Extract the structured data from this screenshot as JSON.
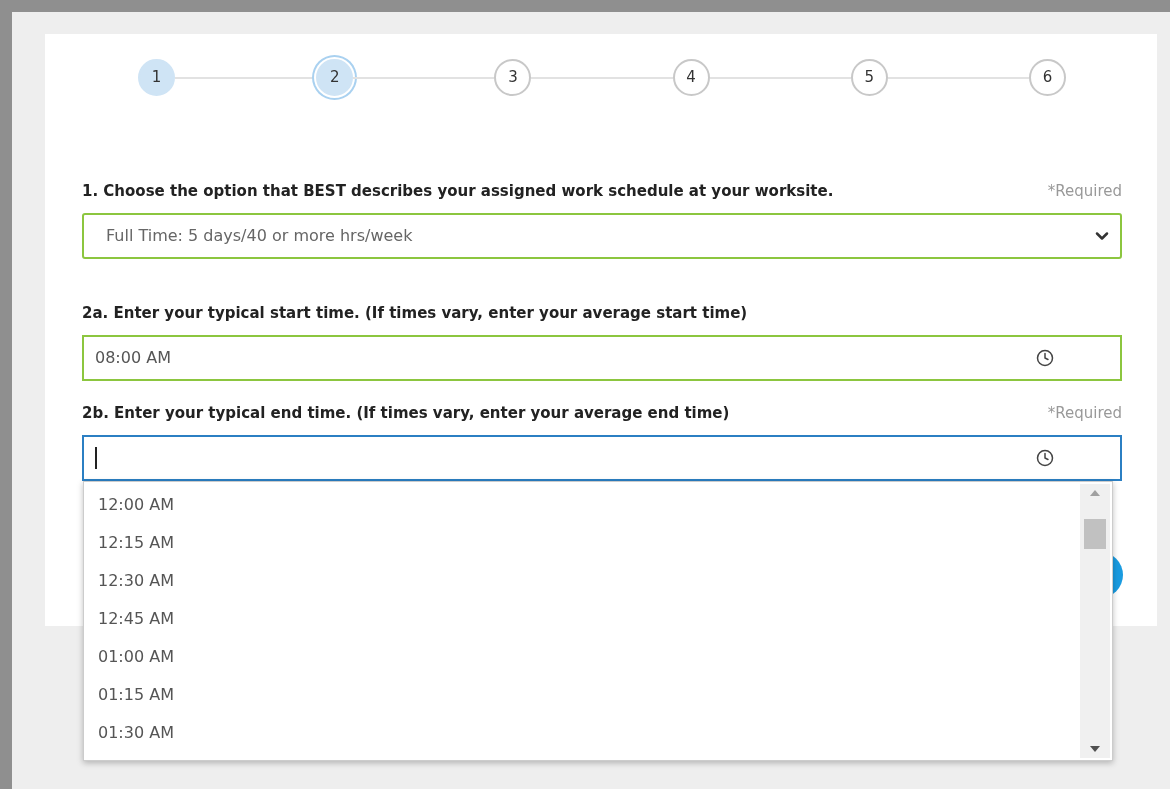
{
  "steps": [
    {
      "label": "1",
      "completed": true,
      "selected": false
    },
    {
      "label": "2",
      "completed": false,
      "selected": true
    },
    {
      "label": "3",
      "completed": false,
      "selected": false
    },
    {
      "label": "4",
      "completed": false,
      "selected": false
    },
    {
      "label": "5",
      "completed": false,
      "selected": false
    },
    {
      "label": "6",
      "completed": false,
      "selected": false
    }
  ],
  "questions": [
    {
      "kind": "select",
      "label": "1. Choose the option that BEST describes your assigned work schedule at your worksite.",
      "required_note": "*Required",
      "value": "Full Time: 5 days/40 or more hrs/week",
      "focused": false
    },
    {
      "kind": "time",
      "label": "2a. Enter your typical start time. (If times vary, enter your average start time)",
      "value": "08:00 AM",
      "focused": false
    },
    {
      "kind": "time",
      "label": "2b. Enter your typical end time. (If times vary, enter your average end time)",
      "required_note": "*Required",
      "focused": true,
      "options": [
        "12:00 AM",
        "12:15 AM",
        "12:30 AM",
        "12:45 AM",
        "01:00 AM",
        "01:15 AM",
        "01:30 AM"
      ]
    }
  ]
}
